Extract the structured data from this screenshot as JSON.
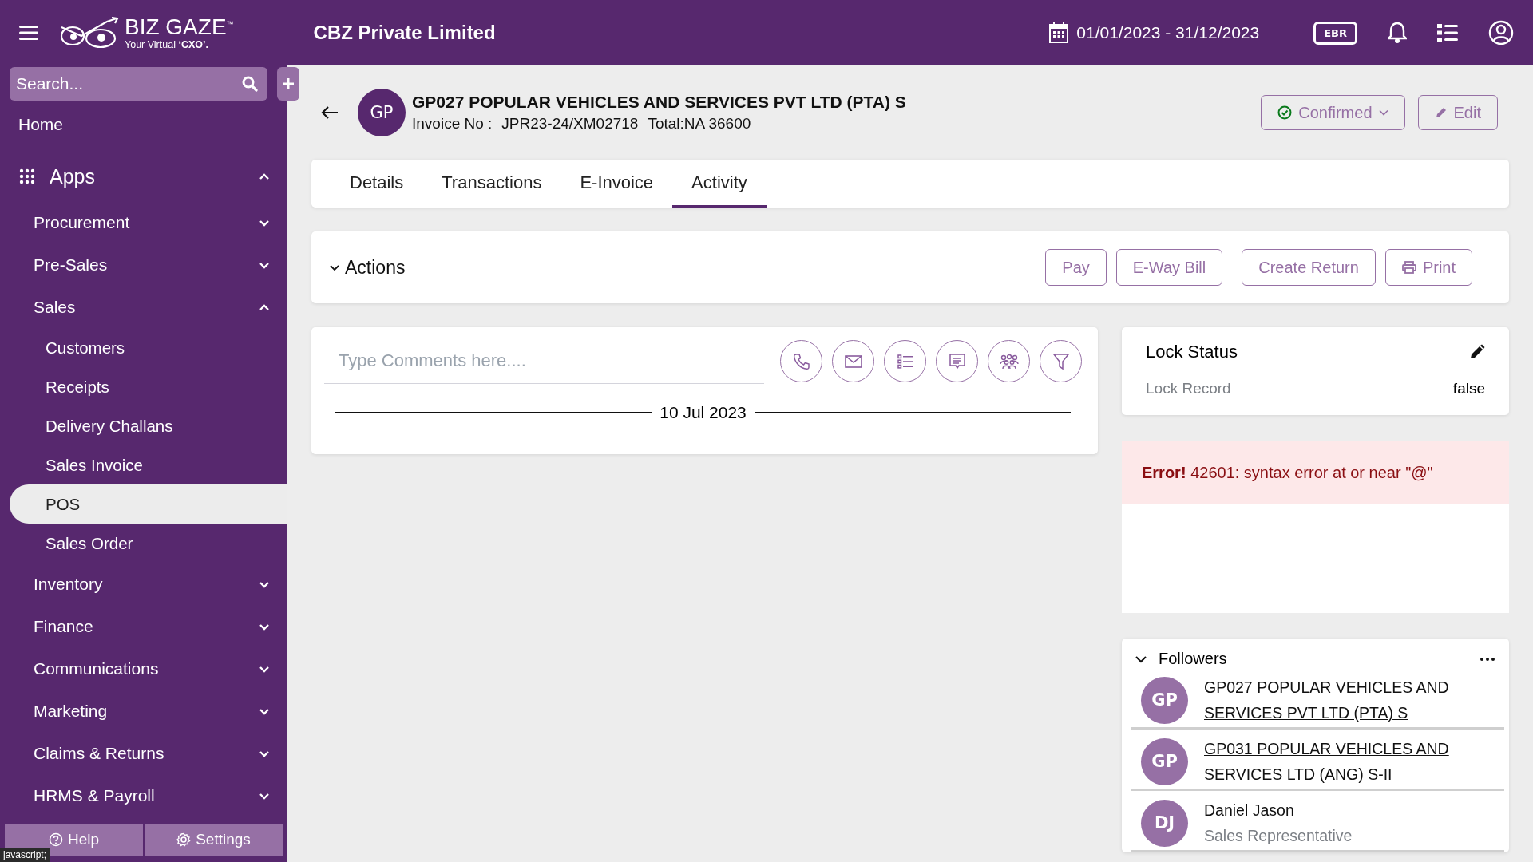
{
  "header": {
    "company": "CBZ Private Limited",
    "date_range": "01/01/2023 - 31/12/2023",
    "badge": "EBR",
    "logo_name": "BIZ GAZE",
    "logo_tm": "™",
    "logo_tagline": "Your Virtual",
    "logo_tagline_bold": "‘CXO’."
  },
  "sidebar": {
    "search_placeholder": "Search...",
    "home": "Home",
    "apps": {
      "label": "Apps",
      "expanded": true
    },
    "items": [
      {
        "label": "Procurement",
        "expanded": false
      },
      {
        "label": "Pre-Sales",
        "expanded": false
      },
      {
        "label": "Sales",
        "expanded": true,
        "children": [
          {
            "label": "Customers",
            "selected": false
          },
          {
            "label": "Receipts",
            "selected": false
          },
          {
            "label": "Delivery Challans",
            "selected": false
          },
          {
            "label": "Sales Invoice",
            "selected": false
          },
          {
            "label": "POS",
            "selected": true
          },
          {
            "label": "Sales Order",
            "selected": false
          }
        ]
      },
      {
        "label": "Inventory",
        "expanded": false
      },
      {
        "label": "Finance",
        "expanded": false
      },
      {
        "label": "Communications",
        "expanded": false
      },
      {
        "label": "Marketing",
        "expanded": false
      },
      {
        "label": "Claims & Returns",
        "expanded": false
      },
      {
        "label": "HRMS & Payroll",
        "expanded": false
      }
    ],
    "footer": [
      {
        "label": "Help",
        "kind": "help"
      },
      {
        "label": "Settings",
        "kind": "settings"
      }
    ]
  },
  "status_tooltip": "javascript;",
  "record": {
    "initials": "GP",
    "title": "GP027 POPULAR VEHICLES AND SERVICES PVT LTD (PTA) S",
    "invoice_label": "Invoice No :",
    "invoice_no": "JPR23-24/XM02718",
    "total": "Total:NA 36600",
    "status": "Confirmed",
    "edit": "Edit"
  },
  "tabs": [
    {
      "label": "Details",
      "selected": false
    },
    {
      "label": "Transactions",
      "selected": false
    },
    {
      "label": "E-Invoice",
      "selected": false
    },
    {
      "label": "Activity",
      "selected": true
    }
  ],
  "actions": {
    "title": "Actions",
    "expanded": true,
    "buttons": [
      {
        "label": "Pay",
        "kind": "plain"
      },
      {
        "label": "E-Way Bill",
        "kind": "plain"
      },
      {
        "label": "Create Return",
        "kind": "plain"
      },
      {
        "label": "Print",
        "kind": "print"
      }
    ]
  },
  "activity": {
    "placeholder": "Type Comments here....",
    "date": "10 Jul 2023"
  },
  "lock": {
    "title": "Lock Status",
    "label": "Lock Record",
    "value": "false"
  },
  "error": "**Error!** 42601: syntax error at or near \"@\"",
  "followers": {
    "title": "Followers",
    "expanded": true,
    "items": [
      {
        "initials": "GP",
        "name": "GP027 POPULAR VEHICLES AND SERVICES PVT LTD (PTA) S"
      },
      {
        "initials": "GP",
        "name": "GP031 POPULAR VEHICLES AND SERVICES LTD (ANG) S-II"
      },
      {
        "initials": "DJ",
        "name": "Daniel Jason",
        "subtitle": "Sales Representative"
      }
    ]
  }
}
